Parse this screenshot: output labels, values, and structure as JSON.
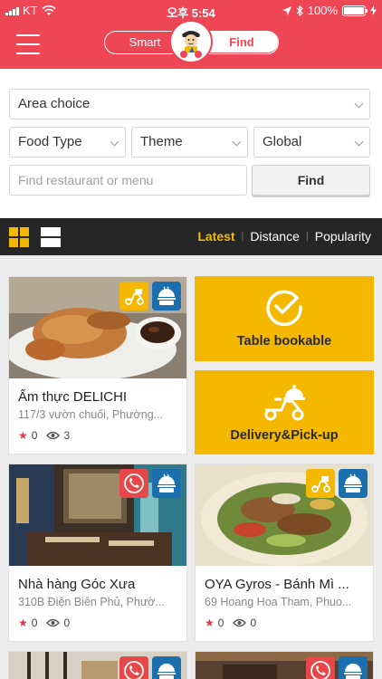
{
  "status_bar": {
    "carrier": "KT",
    "time": "오후 5:54",
    "battery": "100%",
    "battery_level": 1.0
  },
  "header": {
    "toggle_smart": "Smart",
    "toggle_find": "Find"
  },
  "search": {
    "area": "Area choice",
    "food_type": "Food Type",
    "theme": "Theme",
    "region": "Global",
    "query_placeholder": "Find restaurant or menu",
    "find_button": "Find"
  },
  "sort": {
    "options": [
      "Latest",
      "Distance",
      "Popularity"
    ],
    "active": "Latest"
  },
  "quick_tiles": [
    {
      "label": "Table bookable",
      "icon": "check-circle-icon"
    },
    {
      "label": "Delivery&Pick-up",
      "icon": "delivery-scooter-icon"
    }
  ],
  "restaurants": [
    {
      "name": "Ẩm thực DELICHI",
      "address": "117/3 vườn chuối, Phường...",
      "rating": "0",
      "views": "3",
      "badges": [
        "delivery-scooter-icon",
        "takeout-box-icon"
      ]
    },
    {
      "name": "Nhà hàng Góc Xưa",
      "address": "310B Điện Biên Phủ, Phườ...",
      "rating": "0",
      "views": "0",
      "badges": [
        "phone-reservation-icon",
        "takeout-box-icon"
      ]
    },
    {
      "name": "OYA Gyros - Bánh Mì ...",
      "address": "69 Hoang Hoa Tham, Phuo...",
      "rating": "0",
      "views": "0",
      "badges": [
        "delivery-scooter-icon",
        "takeout-box-icon"
      ]
    }
  ],
  "colors": {
    "brand_red": "#ef4656",
    "accent_yellow": "#f5b800",
    "badge_blue": "#1c6fae",
    "dark_bar": "#262626"
  }
}
